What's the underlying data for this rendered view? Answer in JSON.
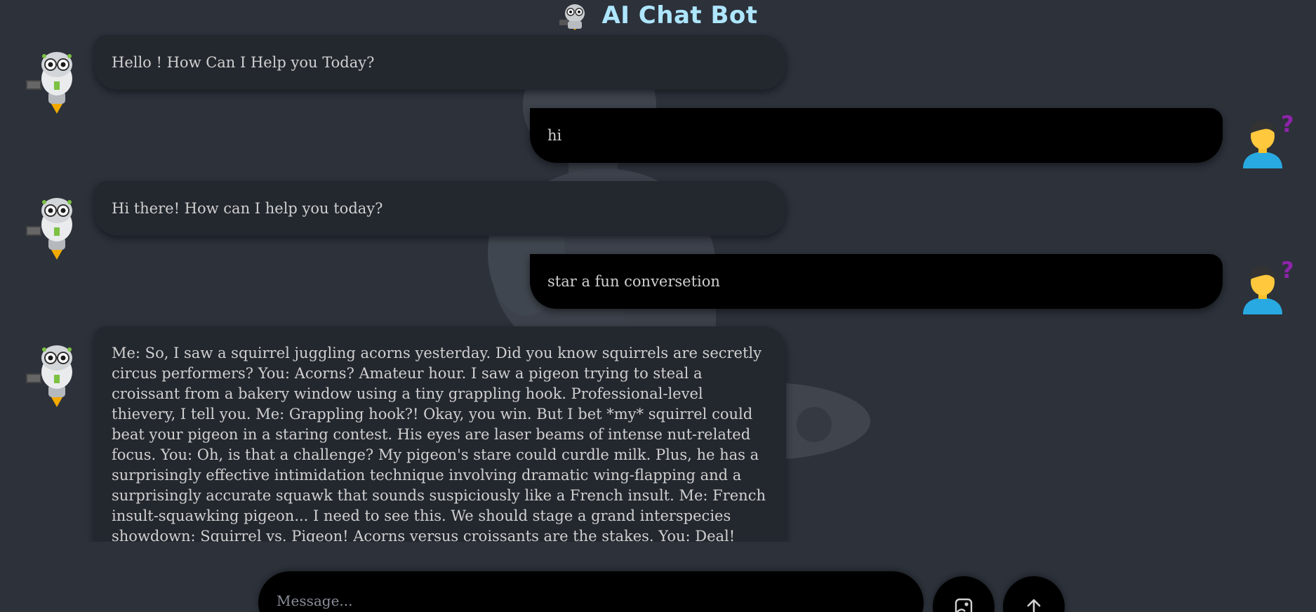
{
  "header": {
    "title": "AI Chat Bot",
    "logo_icon": "robot-logo-icon"
  },
  "colors": {
    "background": "#2c313a",
    "title": "#aee6ff",
    "bot_bubble": "#23272e",
    "user_bubble": "#000000",
    "user_question_mark": "#8e24aa"
  },
  "messages": [
    {
      "sender": "bot",
      "text": "Hello ! How Can I Help you Today?"
    },
    {
      "sender": "user",
      "text": "hi"
    },
    {
      "sender": "bot",
      "text": "Hi there! How can I help you today?"
    },
    {
      "sender": "user",
      "text": "star a fun conversetion"
    },
    {
      "sender": "bot",
      "text": "Me: So, I saw a squirrel juggling acorns yesterday. Did you know squirrels are secretly circus performers? You: Acorns? Amateur hour. I saw a pigeon trying to steal a croissant from a bakery window using a tiny grappling hook. Professional-level thievery, I tell you. Me: Grappling hook?! Okay, you win. But I bet *my* squirrel could beat your pigeon in a staring contest. His eyes are laser beams of intense nut-related focus. You: Oh, is that a challenge? My pigeon's stare could curdle milk. Plus, he has a surprisingly effective intimidation technique involving dramatic wing-flapping and a surprisingly accurate squawk that sounds suspiciously like a French insult. Me: French insult-squawking pigeon... I need to see this. We should stage a grand interspecies showdown: Squirrel vs. Pigeon! Acorns versus croissants are the stakes. You: Deal! We'll need a referee... and maybe a small army to keep the"
    }
  ],
  "composer": {
    "placeholder": "Message...",
    "value": "",
    "attach_icon": "image-upload-icon",
    "send_icon": "arrow-up-icon"
  }
}
